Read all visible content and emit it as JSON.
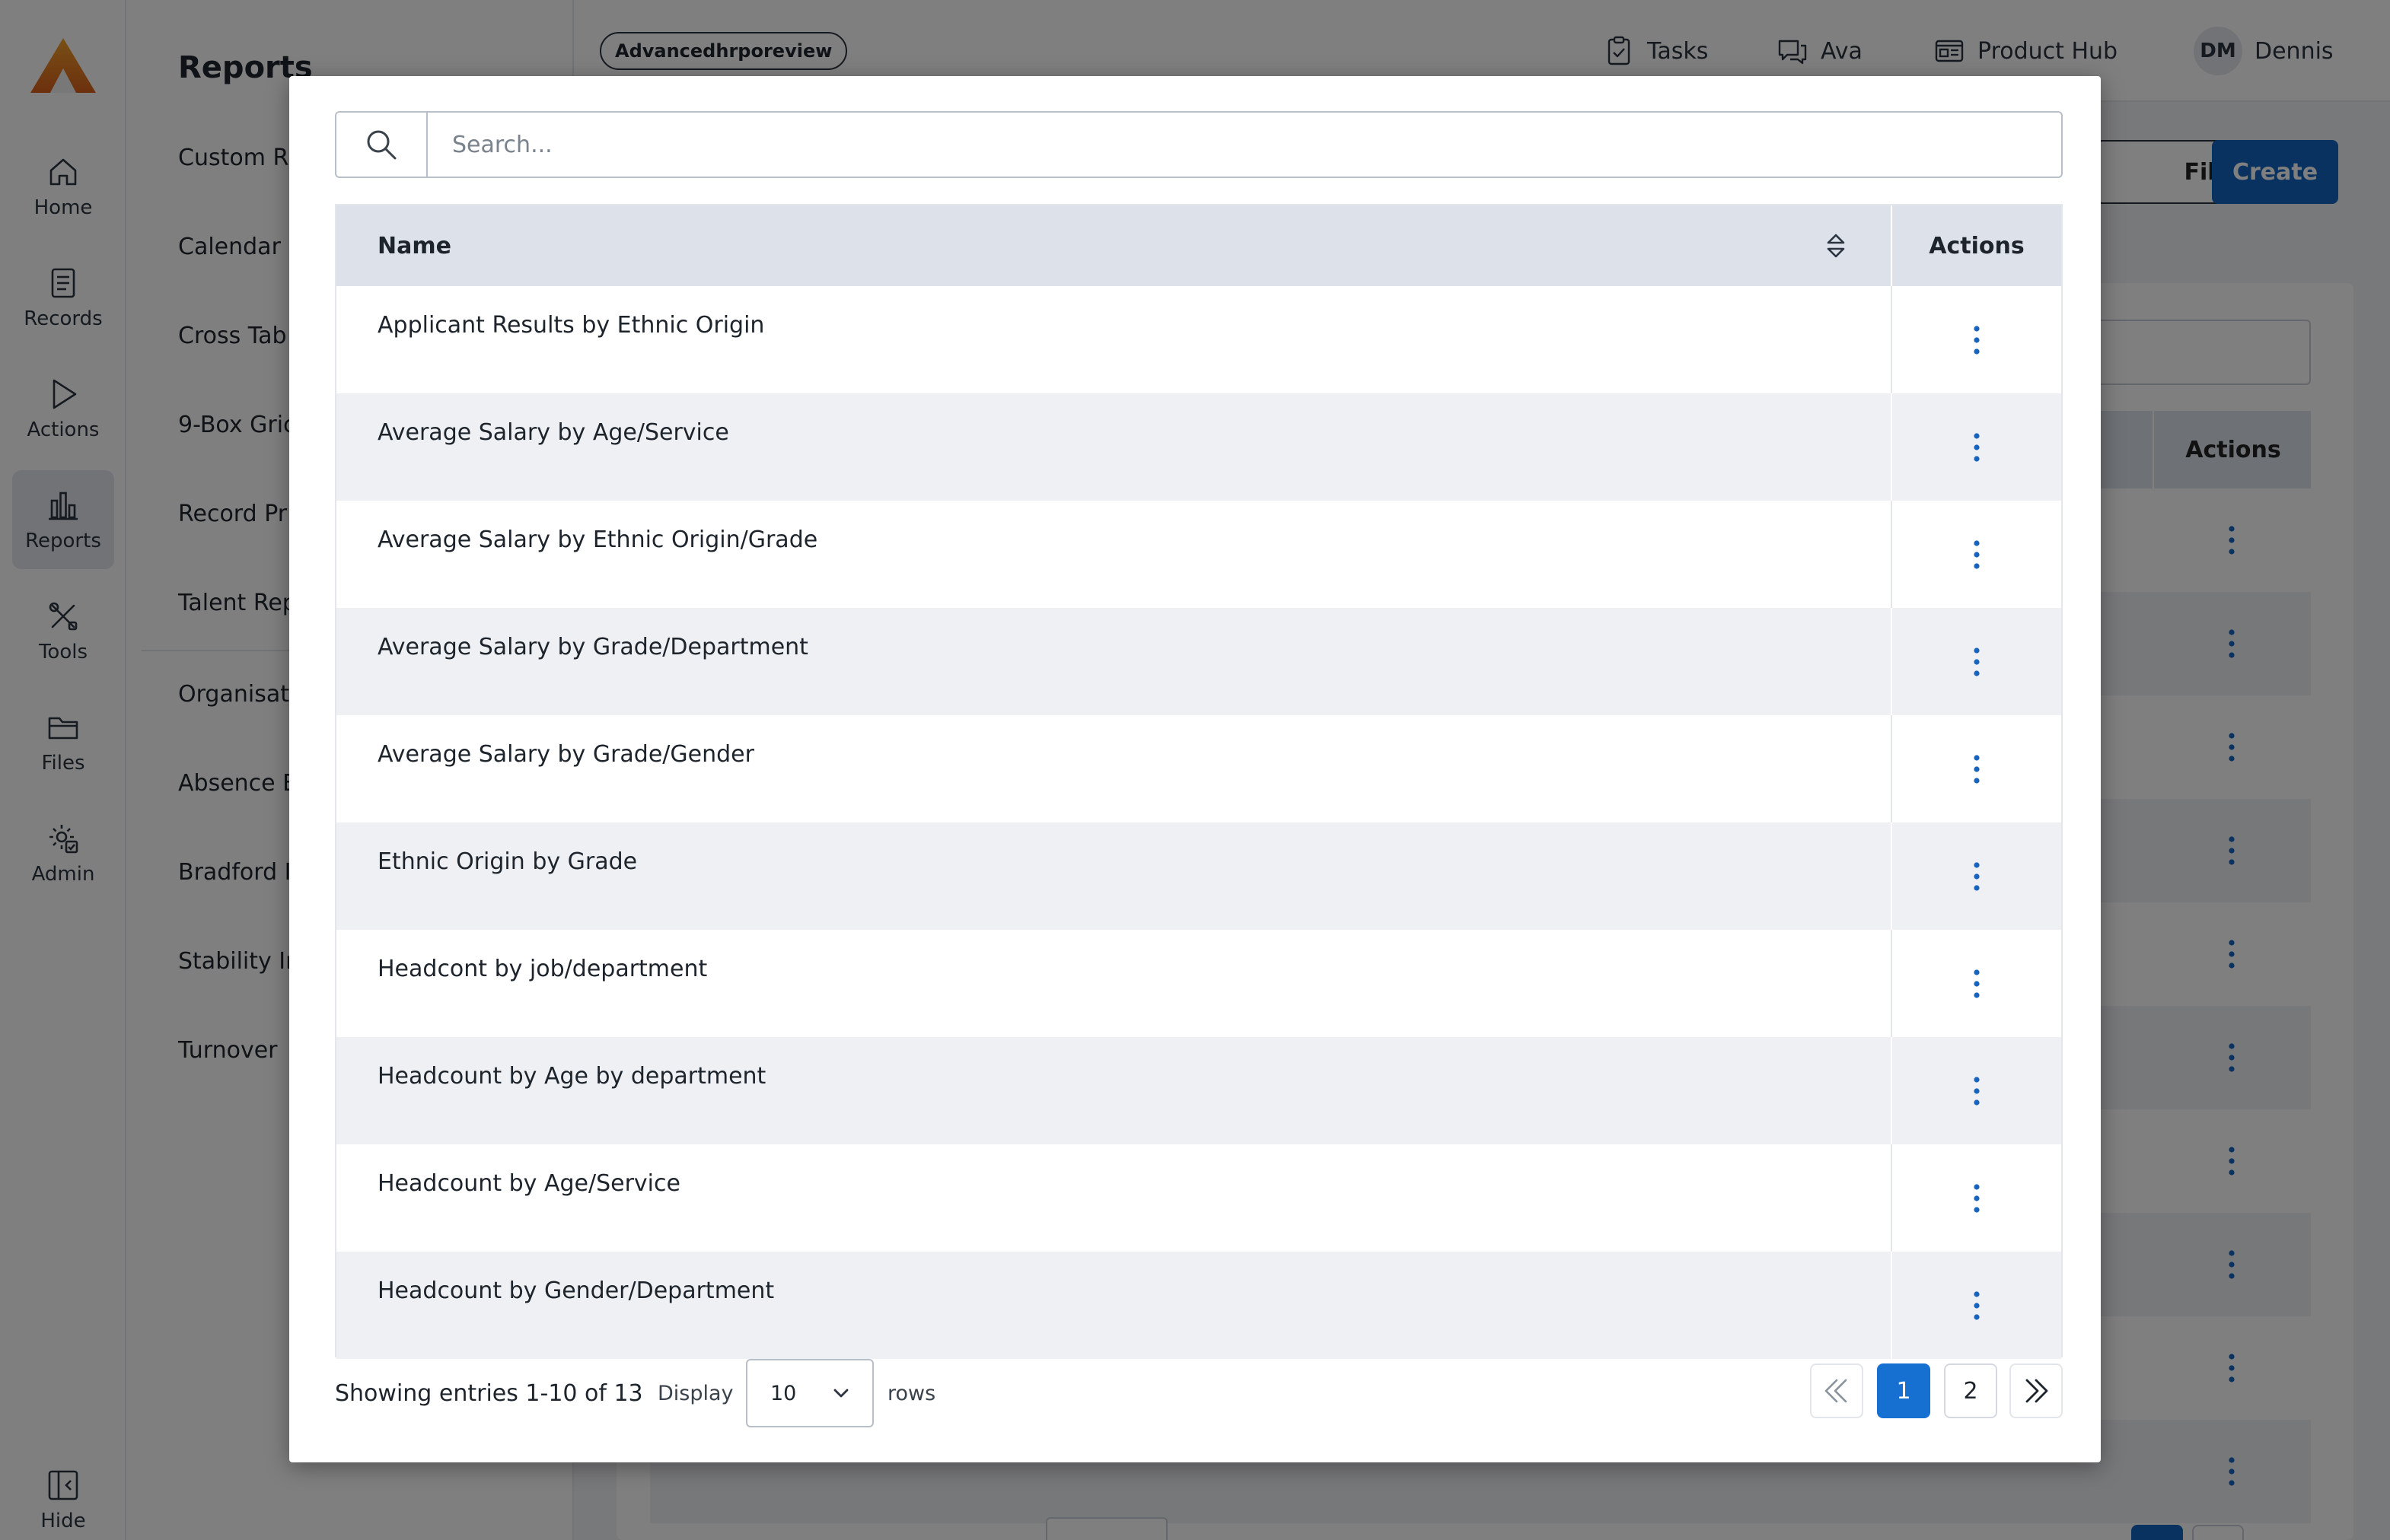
{
  "nav": {
    "items": [
      {
        "label": "Home",
        "icon": "home-icon"
      },
      {
        "label": "Records",
        "icon": "records-icon"
      },
      {
        "label": "Actions",
        "icon": "play-icon"
      },
      {
        "label": "Reports",
        "icon": "bar-chart-icon",
        "active": true
      },
      {
        "label": "Tools",
        "icon": "tools-icon"
      },
      {
        "label": "Files",
        "icon": "folder-icon"
      },
      {
        "label": "Admin",
        "icon": "gear-check-icon"
      }
    ],
    "hide_label": "Hide"
  },
  "submenu": {
    "title": "Reports",
    "items": [
      "Custom R",
      "Calendar",
      "Cross Tab",
      "9-Box Gric",
      "Record Pr",
      "Talent Rep",
      "Organisat",
      "Absence E",
      "Bradford I",
      "Stability Ir",
      "Turnover"
    ]
  },
  "topbar": {
    "environment": "Advancedhrporeview",
    "links": {
      "tasks": "Tasks",
      "ava": "Ava",
      "product_hub": "Product Hub"
    },
    "user": {
      "initials": "DM",
      "name": "Dennis"
    }
  },
  "background": {
    "filter_label": "Filter",
    "create_label": "Create",
    "actions_header": "Actions"
  },
  "modal": {
    "search": {
      "placeholder": "Search...",
      "value": ""
    },
    "table": {
      "columns": {
        "name": "Name",
        "actions": "Actions"
      },
      "rows": [
        "Applicant Results by Ethnic Origin",
        "Average Salary by Age/Service",
        "Average Salary by Ethnic Origin/Grade",
        "Average Salary by Grade/Department",
        "Average Salary by Grade/Gender",
        "Ethnic Origin by Grade",
        "Headcont by job/department",
        "Headcount by Age by department",
        "Headcount by Age/Service",
        "Headcount by Gender/Department"
      ]
    },
    "footer": {
      "showing": "Showing entries 1-10 of 13",
      "display_label": "Display",
      "rows_per_page": "10",
      "rows_label": "rows",
      "pages": [
        "1",
        "2"
      ],
      "current_page": "1"
    }
  },
  "colors": {
    "accent": "#1570d2",
    "logo_top": "#f2a12c",
    "logo_bottom": "#d96a1f",
    "kebab": "#1565c0"
  }
}
